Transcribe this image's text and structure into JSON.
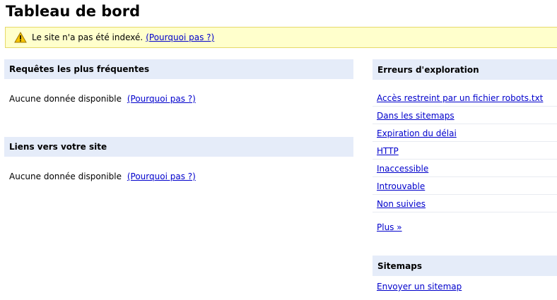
{
  "page": {
    "title": "Tableau de bord"
  },
  "alert": {
    "icon": "warning-icon",
    "text": "Le site n'a pas été indexé.",
    "link_label": "(Pourquoi pas ?)",
    "background_color": "#ffffcc",
    "border_color": "#e6d96a"
  },
  "left": {
    "top_queries": {
      "header": "Requêtes les plus fréquentes",
      "empty_text": "Aucune donnée disponible",
      "why_link": "(Pourquoi pas ?)"
    },
    "links_to_site": {
      "header": "Liens vers votre site",
      "empty_text": "Aucune donnée disponible",
      "why_link": "(Pourquoi pas ?)"
    }
  },
  "right": {
    "crawl_errors": {
      "header": "Erreurs d'exploration",
      "items": [
        "Accès restreint par un fichier robots.txt",
        "Dans les sitemaps",
        "Expiration du délai",
        "HTTP",
        "Inaccessible",
        "Introuvable",
        "Non suivies"
      ],
      "more_link": "Plus »"
    },
    "sitemaps": {
      "header": "Sitemaps",
      "submit_link": "Envoyer un sitemap"
    }
  },
  "colors": {
    "header_background": "#e5ecf9",
    "link": "#0000cc"
  }
}
